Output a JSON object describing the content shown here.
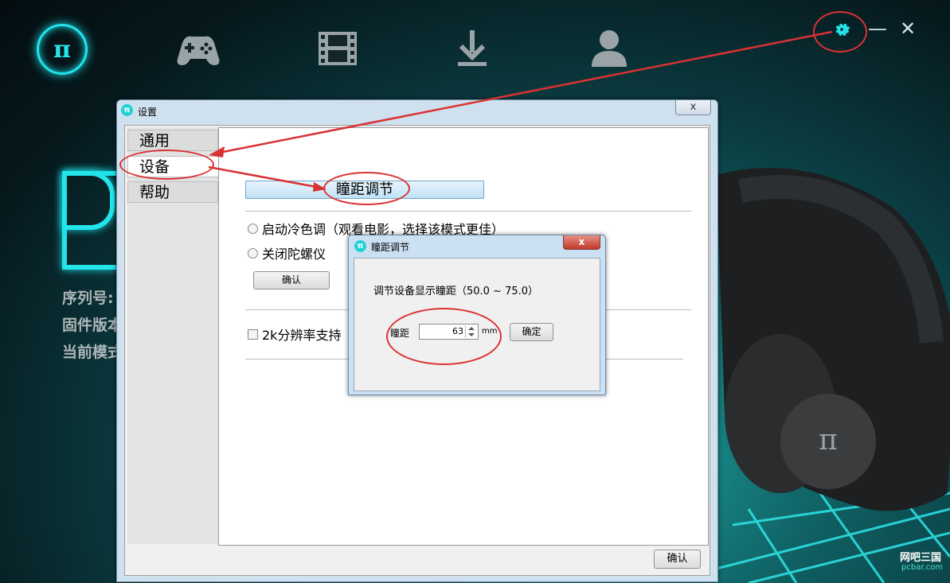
{
  "app": {
    "logo_symbol": "π",
    "nav": [
      "game-controller-icon",
      "film-icon",
      "download-icon",
      "user-icon"
    ],
    "window_controls": {
      "minimize": "—",
      "close": "✕"
    },
    "accent_color": "#22e4ea",
    "left_info": [
      "序列号:",
      "固件版本",
      "当前模式"
    ],
    "big_letter": "P"
  },
  "settings": {
    "title": "设置",
    "close": "x",
    "tabs": [
      "通用",
      "设备",
      "帮助"
    ],
    "active_tab": "设备",
    "ipd_button": "瞳距调节",
    "cool_tone": "启动冷色调（观看电影，选择该模式更佳）",
    "close_gyro": "关闭陀螺仪",
    "confirm_small": "确认",
    "support_2k": "2k分辨率支持（",
    "confirm_bottom": "确认"
  },
  "ipd_dialog": {
    "title": "瞳距调节",
    "close": "x",
    "description": "调节设备显示瞳距（50.0 ~ 75.0）",
    "field_label": "瞳距",
    "value": "63",
    "unit": "mm",
    "ok_button": "确定"
  },
  "watermark": {
    "brand": "网吧三国",
    "domain": "pcbar.com"
  }
}
